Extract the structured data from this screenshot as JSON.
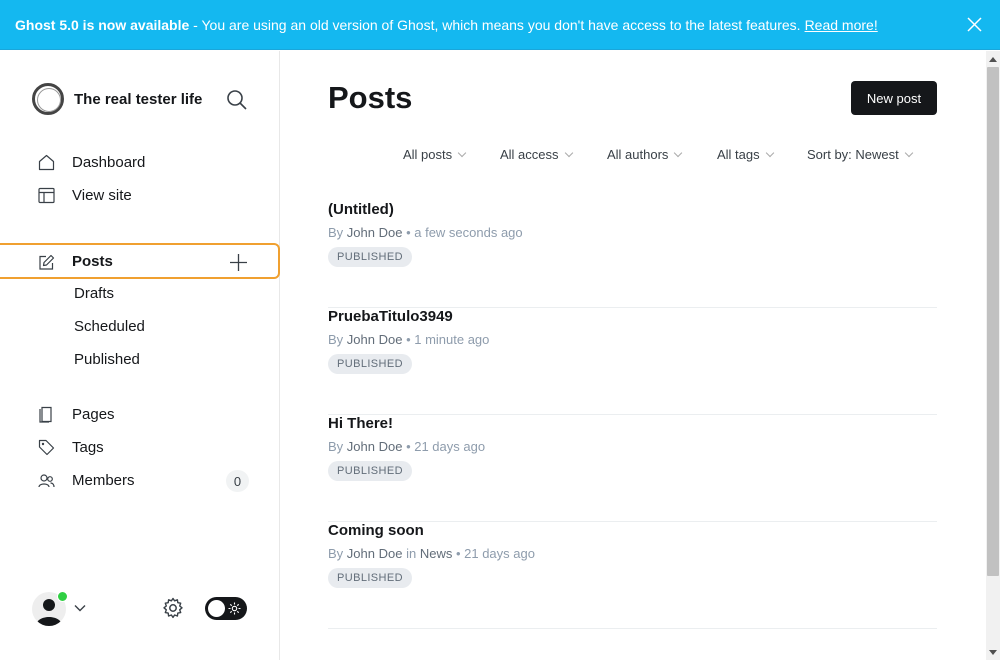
{
  "banner": {
    "strong": "Ghost 5.0 is now available",
    "text": " - You are using an old version of Ghost, which means you don't have access to the latest features.",
    "link": "Read more!"
  },
  "sidebar": {
    "brand": "The real tester life",
    "nav": {
      "dashboard": "Dashboard",
      "view_site": "View site",
      "posts": "Posts",
      "drafts": "Drafts",
      "scheduled": "Scheduled",
      "published": "Published",
      "pages": "Pages",
      "tags": "Tags",
      "members": "Members",
      "members_count": "0"
    }
  },
  "main": {
    "title": "Posts",
    "new_post": "New post",
    "filters": {
      "type": "All posts",
      "access": "All access",
      "authors": "All authors",
      "tags": "All tags",
      "sort": "Sort by: Newest"
    },
    "posts": [
      {
        "title": "(Untitled)",
        "by": "By",
        "author": "John Doe",
        "in": "",
        "tag": "",
        "time": "a few seconds ago",
        "status": "PUBLISHED"
      },
      {
        "title": "PruebaTitulo3949",
        "by": "By",
        "author": "John Doe",
        "in": "",
        "tag": "",
        "time": "1 minute ago",
        "status": "PUBLISHED"
      },
      {
        "title": "Hi There!",
        "by": "By",
        "author": "John Doe",
        "in": "",
        "tag": "",
        "time": "21 days ago",
        "status": "PUBLISHED"
      },
      {
        "title": "Coming soon",
        "by": "By",
        "author": "John Doe",
        "in": "in",
        "tag": "News",
        "time": "21 days ago",
        "status": "PUBLISHED"
      }
    ]
  },
  "colors": {
    "banner_bg": "#14b8f0",
    "active_outline": "#f0a030",
    "primary_button": "#15171a",
    "online": "#30cf43"
  },
  "icons": {
    "banner_close": "close-icon",
    "search": "search-icon",
    "dashboard": "home-icon",
    "view_site": "layout-icon",
    "posts": "edit-icon",
    "new_post": "plus-icon",
    "pages": "page-icon",
    "tags": "tag-icon",
    "members": "users-icon",
    "settings": "gear-icon",
    "theme": "sun-icon"
  }
}
